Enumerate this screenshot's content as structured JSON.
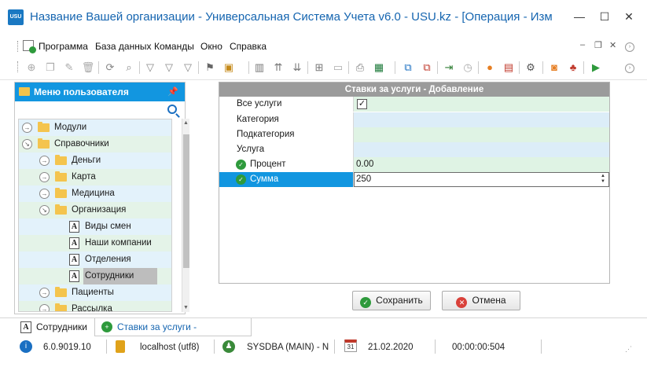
{
  "window": {
    "title": "Название Вашей организации - Универсальная Система Учета v6.0 - USU.kz - [Операция - Изм",
    "app_icon_text": "USU",
    "minimize": "—",
    "maximize": "☐",
    "close": "✕",
    "mdi_minimize": "–",
    "mdi_restore": "❐",
    "mdi_close": "✕"
  },
  "menu": {
    "items": [
      "Программа",
      "База данных",
      "Команды",
      "Окно",
      "Справка"
    ]
  },
  "left_panel": {
    "title": "Меню пользователя",
    "tree": [
      {
        "label": "Модули",
        "level": 0,
        "kind": "folder",
        "expanded": false
      },
      {
        "label": "Справочники",
        "level": 0,
        "kind": "folder",
        "expanded": true
      },
      {
        "label": "Деньги",
        "level": 1,
        "kind": "folder",
        "expanded": false
      },
      {
        "label": "Карта",
        "level": 1,
        "kind": "folder",
        "expanded": false
      },
      {
        "label": "Медицина",
        "level": 1,
        "kind": "folder",
        "expanded": false
      },
      {
        "label": "Организация",
        "level": 1,
        "kind": "folder",
        "expanded": true
      },
      {
        "label": "Виды смен",
        "level": 2,
        "kind": "doc"
      },
      {
        "label": "Наши компании",
        "level": 2,
        "kind": "doc"
      },
      {
        "label": "Отделения",
        "level": 2,
        "kind": "doc"
      },
      {
        "label": "Сотрудники",
        "level": 2,
        "kind": "doc",
        "selected": true
      },
      {
        "label": "Пациенты",
        "level": 1,
        "kind": "folder",
        "expanded": false
      },
      {
        "label": "Рассылка",
        "level": 1,
        "kind": "folder",
        "expanded": false
      }
    ]
  },
  "form": {
    "title": "Ставки за услуги - Добавление",
    "rows": [
      {
        "label": "Все услуги",
        "value": "✓",
        "type": "checkbox"
      },
      {
        "label": "Категория",
        "value": ""
      },
      {
        "label": "Подкатегория",
        "value": ""
      },
      {
        "label": "Услуга",
        "value": ""
      },
      {
        "label": "Процент",
        "value": "0.00",
        "required": true
      },
      {
        "label": "Сумма",
        "value": "250",
        "required": true,
        "active": true
      }
    ]
  },
  "buttons": {
    "save": "Сохранить",
    "cancel": "Отмена"
  },
  "tabs": [
    {
      "label": "Сотрудники",
      "active": false
    },
    {
      "label": "Ставки за услуги - Добавление",
      "active": true
    }
  ],
  "status": {
    "version": "6.0.9019.10",
    "db": "localhost (utf8)",
    "user": "SYSDBA (MAIN) - N",
    "date": "21.02.2020",
    "calendar_day": "31",
    "timer": "00:00:00:504"
  },
  "colors": {
    "accent": "#1296e0",
    "title_text": "#1565b0",
    "row_green": "#dff3e4",
    "row_blue": "#dcedf8",
    "header_gray": "#9b9b9b"
  }
}
